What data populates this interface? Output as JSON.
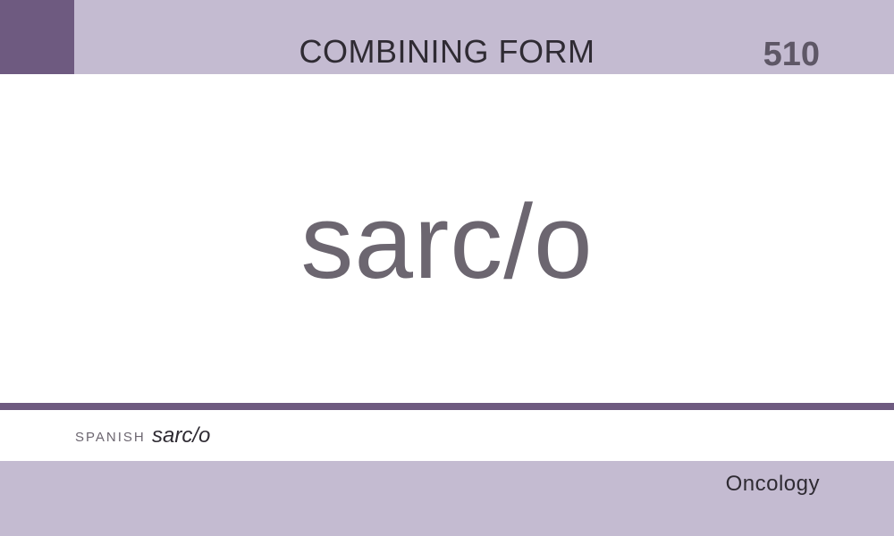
{
  "header": {
    "card_type": "COMBINING FORM",
    "card_number": "510"
  },
  "main": {
    "term": "sarc/o"
  },
  "translation": {
    "language_label": "SPANISH",
    "term": "sarc/o"
  },
  "footer": {
    "category": "Oncology"
  },
  "colors": {
    "accent_dark": "#6e5a80",
    "accent_light": "#c4bbd1",
    "term_text": "#6c6670"
  }
}
